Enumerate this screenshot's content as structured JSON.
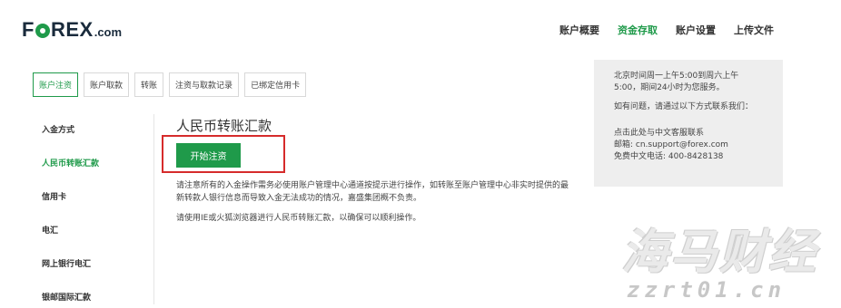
{
  "header": {
    "logo_prefix": "F",
    "logo_suffix": "REX",
    "logo_domain": ".com",
    "nav": [
      "账户概要",
      "资金存取",
      "账户设置",
      "上传文件"
    ],
    "nav_active": 1
  },
  "tabs": {
    "items": [
      "账户注资",
      "账户取款",
      "转账",
      "注资与取款记录",
      "已绑定信用卡"
    ],
    "active": 0
  },
  "sidebar": {
    "items": [
      "入金方式",
      "人民币转账汇款",
      "信用卡",
      "电汇",
      "网上银行电汇",
      "银邮国际汇款"
    ],
    "active": 1
  },
  "main": {
    "title": "人民币转账汇款",
    "start_button": "开始注资",
    "notice_line1": "请注意所有的入金操作需务必使用账户管理中心通道按提示进行操作，如转账至账户管理中心非实时提供的最",
    "notice_line2": "新转款人银行信息而导致入金无法成功的情况，嘉盛集团概不负责。",
    "notice2": "请使用IE或火狐浏览器进行人民币转账汇款，以确保可以顺利操作。"
  },
  "infobox": {
    "hours_line1": "北京时间周一上午5:00到周六上午",
    "hours_line2": "5:00，期间24小时为您服务。",
    "contact_intro": "如有问题，请通过以下方式联系我们：",
    "cs_link": "点击此处与中文客服联系",
    "email": "邮箱: cn.support@forex.com",
    "phone": "免费中文电话: 400-8428138"
  },
  "watermark": {
    "cn": "海马财经",
    "url": "zzrt01.cn"
  },
  "colors": {
    "brand_green": "#1f9a4a",
    "highlight_red": "#d62b2b",
    "info_bg": "#eeeeee"
  }
}
